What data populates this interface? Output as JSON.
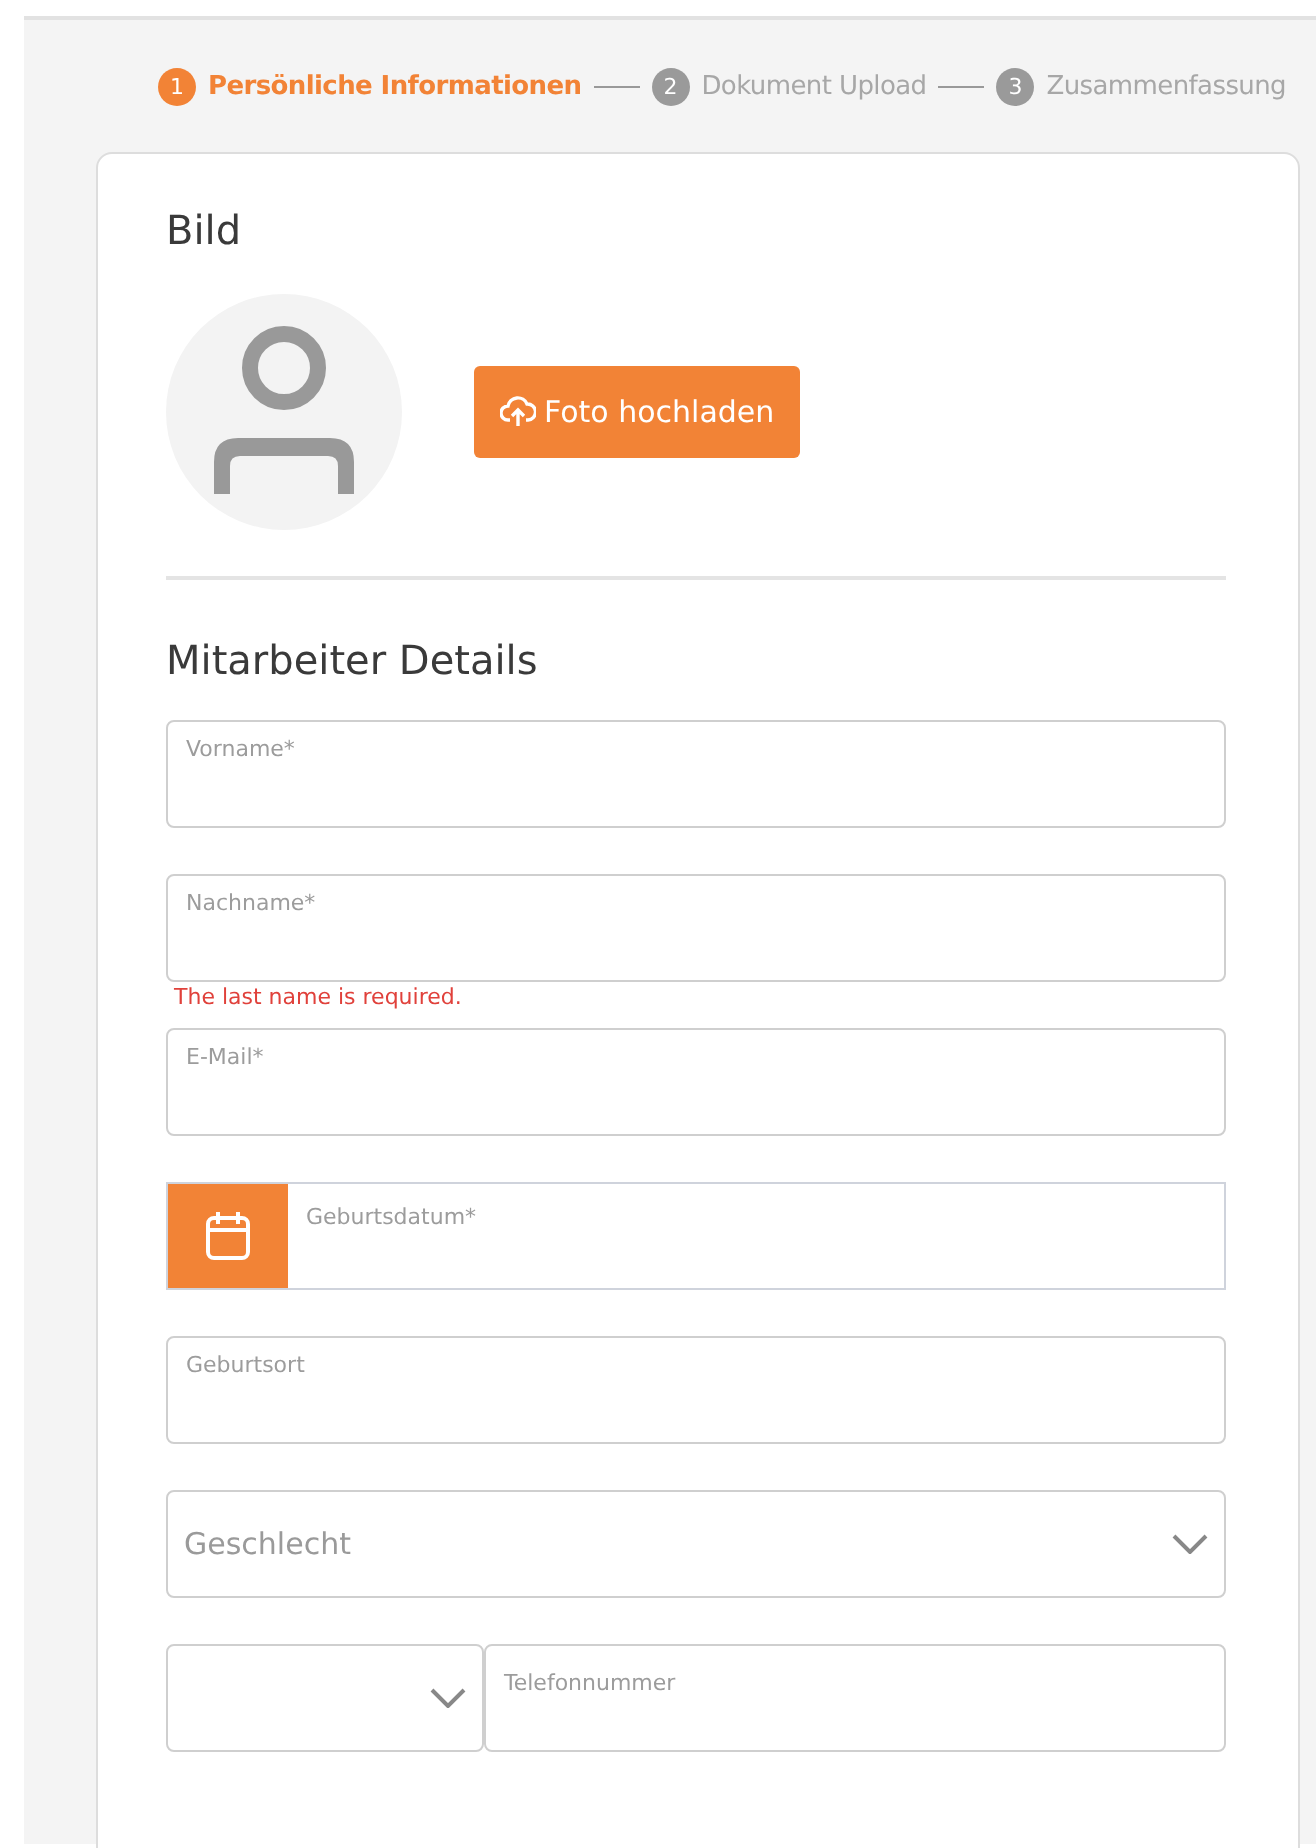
{
  "stepper": [
    {
      "number": "1",
      "label": "Persönliche Informationen",
      "selected": true
    },
    {
      "number": "2",
      "label": "Dokument Upload",
      "selected": false
    },
    {
      "number": "3",
      "label": "Zusammenfassung",
      "selected": false
    }
  ],
  "photo_section": {
    "title": "Bild",
    "upload_button": "Foto hochladen"
  },
  "details_section": {
    "title": "Mitarbeiter Details",
    "fields": [
      {
        "kind": "text",
        "label": "Vorname*"
      },
      {
        "kind": "text",
        "label": "Nachname*",
        "error": "The last name is required."
      },
      {
        "kind": "text",
        "label": "E-Mail*"
      },
      {
        "kind": "date",
        "label": "Geburtsdatum*"
      },
      {
        "kind": "text",
        "label": "Geburtsort"
      },
      {
        "kind": "select",
        "placeholder": "Geschlecht"
      },
      {
        "kind": "phone",
        "label": "Telefonnummer"
      }
    ]
  }
}
